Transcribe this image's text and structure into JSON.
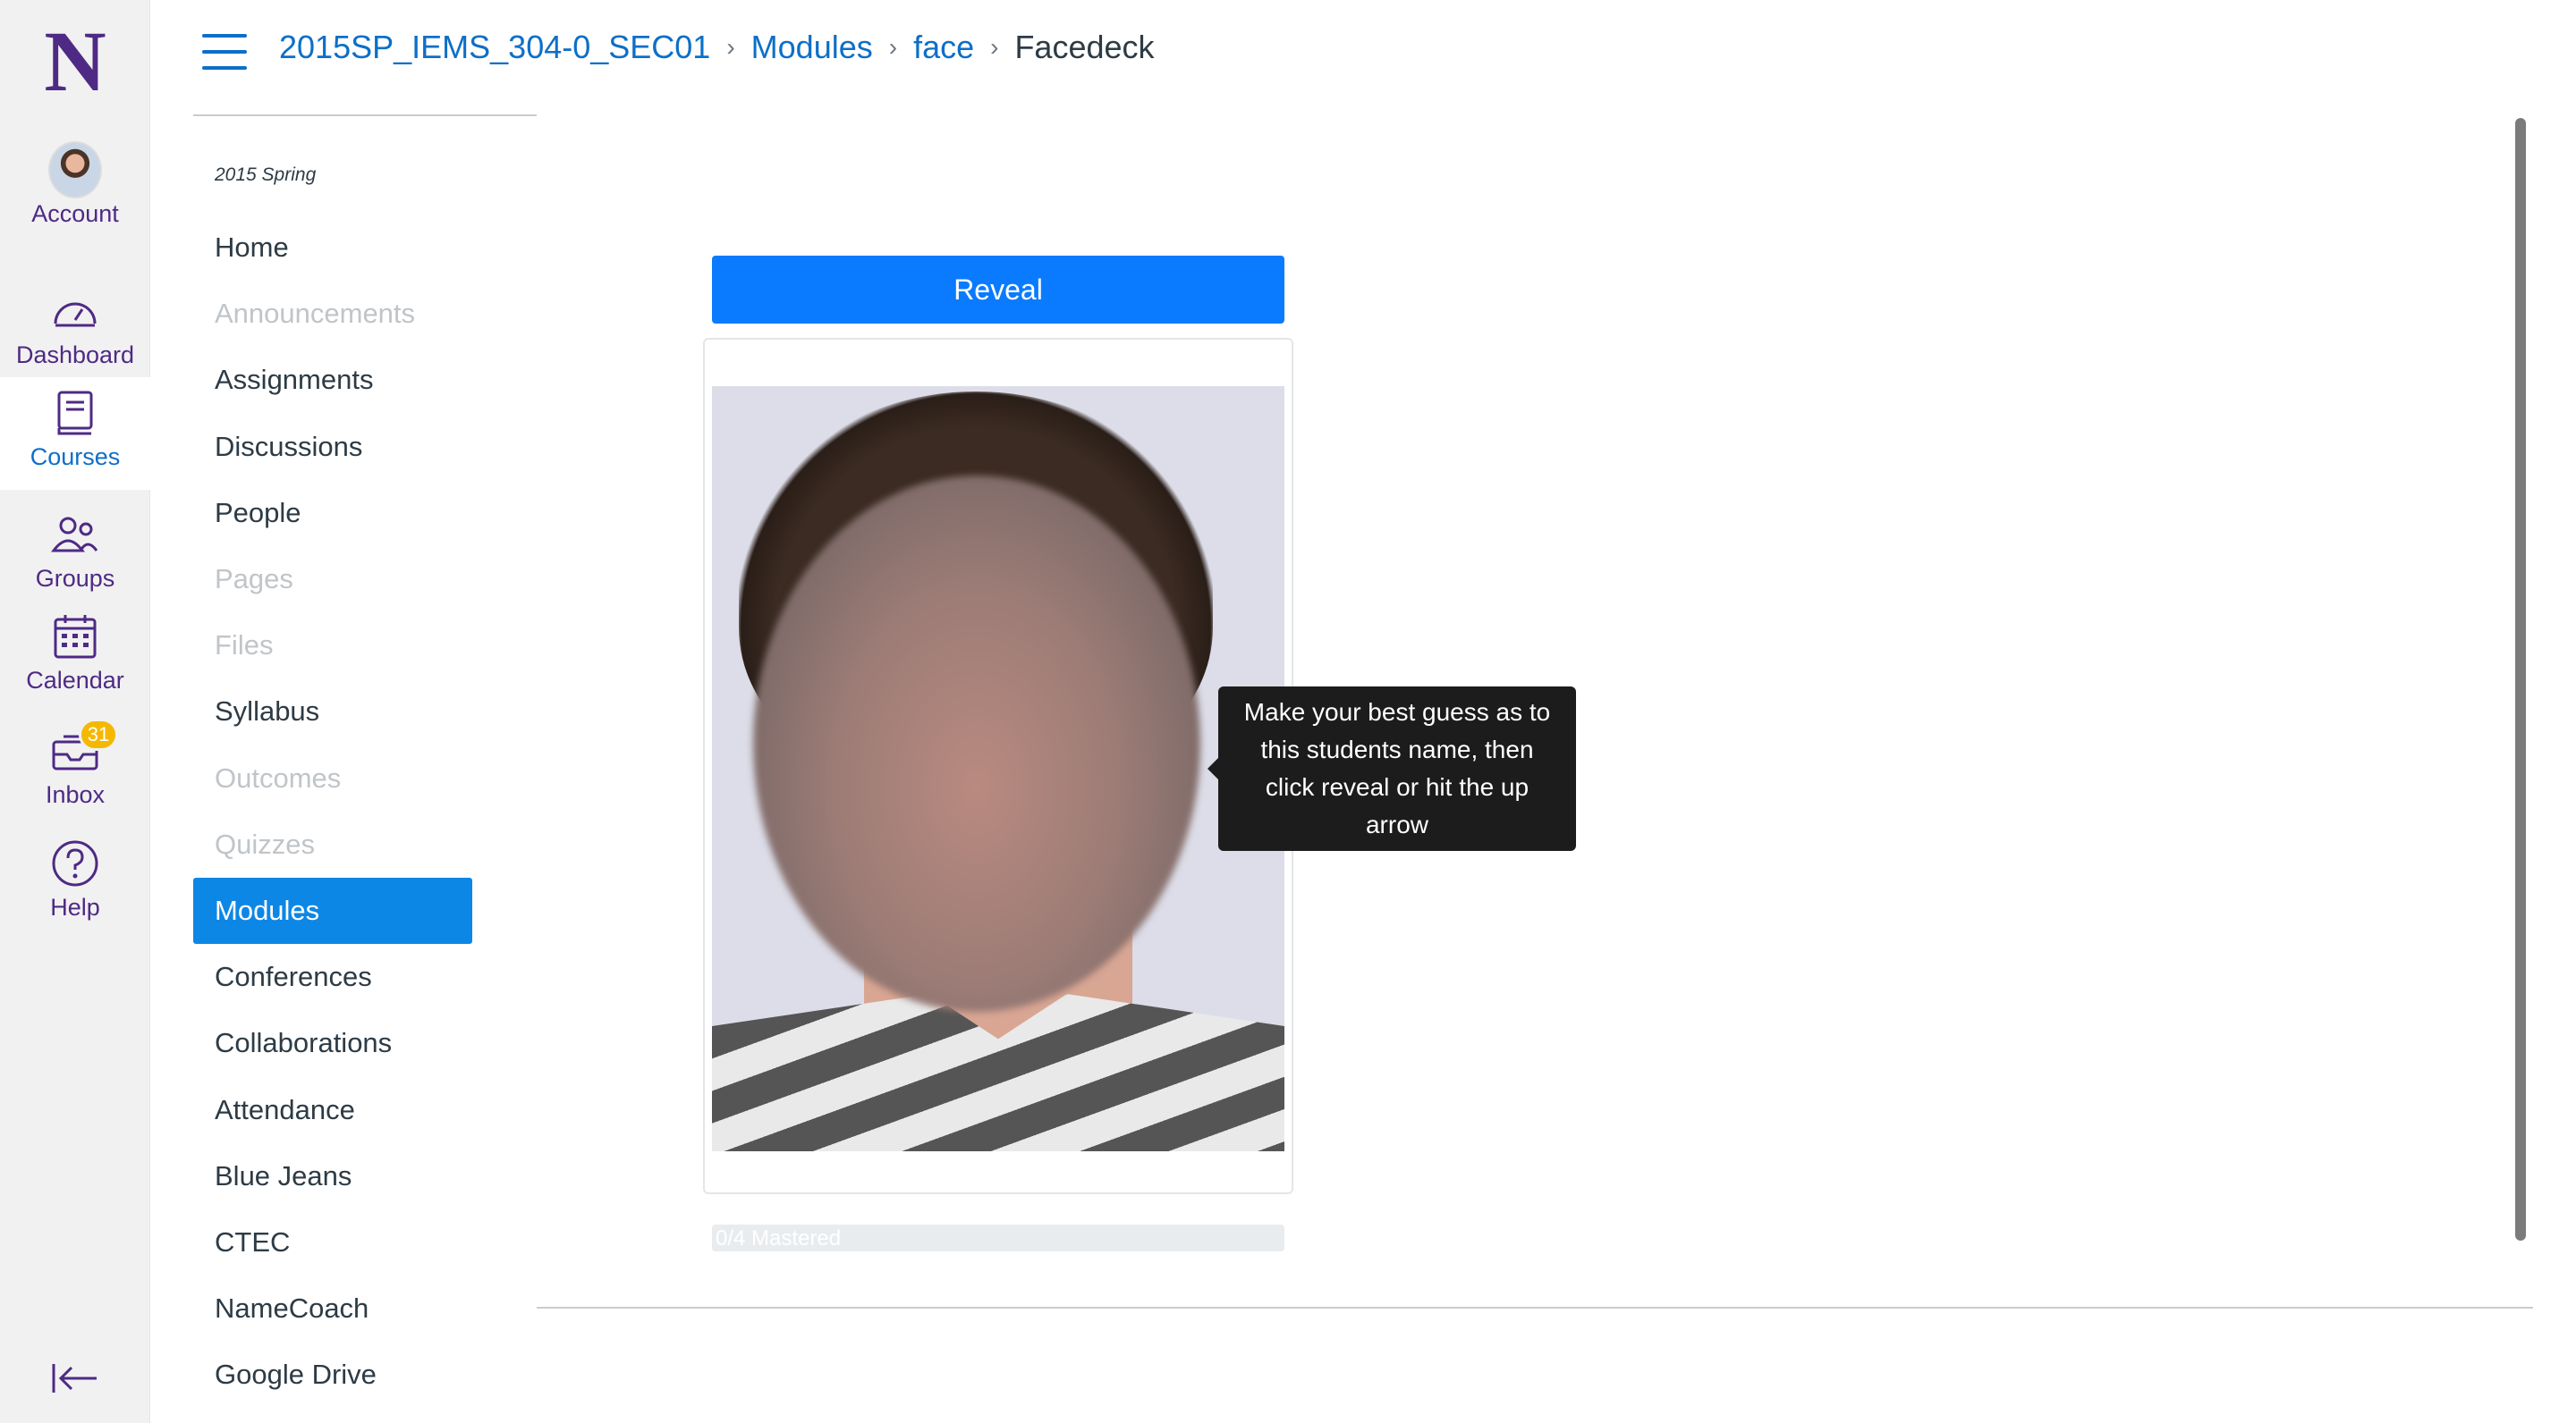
{
  "global_nav": {
    "logo": "N",
    "items": [
      {
        "label": "Account",
        "icon": "avatar"
      },
      {
        "label": "Dashboard",
        "icon": "dashboard-icon"
      },
      {
        "label": "Courses",
        "icon": "courses-icon",
        "active": true
      },
      {
        "label": "Groups",
        "icon": "groups-icon"
      },
      {
        "label": "Calendar",
        "icon": "calendar-icon"
      },
      {
        "label": "Inbox",
        "icon": "inbox-icon",
        "badge": "31"
      },
      {
        "label": "Help",
        "icon": "help-icon"
      }
    ],
    "collapse_icon": "collapse-arrow-icon"
  },
  "breadcrumb": {
    "course": "2015SP_IEMS_304-0_SEC01",
    "modules": "Modules",
    "face": "face",
    "current": "Facedeck"
  },
  "course_nav": {
    "term": "2015 Spring",
    "items": [
      {
        "label": "Home",
        "state": "normal"
      },
      {
        "label": "Announcements",
        "state": "disabled"
      },
      {
        "label": "Assignments",
        "state": "normal"
      },
      {
        "label": "Discussions",
        "state": "normal"
      },
      {
        "label": "People",
        "state": "normal"
      },
      {
        "label": "Pages",
        "state": "disabled"
      },
      {
        "label": "Files",
        "state": "disabled"
      },
      {
        "label": "Syllabus",
        "state": "normal"
      },
      {
        "label": "Outcomes",
        "state": "disabled"
      },
      {
        "label": "Quizzes",
        "state": "disabled"
      },
      {
        "label": "Modules",
        "state": "active"
      },
      {
        "label": "Conferences",
        "state": "normal"
      },
      {
        "label": "Collaborations",
        "state": "normal"
      },
      {
        "label": "Attendance",
        "state": "normal"
      },
      {
        "label": "Blue Jeans",
        "state": "normal"
      },
      {
        "label": "CTEC",
        "state": "normal"
      },
      {
        "label": "NameCoach",
        "state": "normal"
      },
      {
        "label": "Google Drive",
        "state": "normal"
      }
    ]
  },
  "facedeck": {
    "reveal_label": "Reveal",
    "tooltip": "Make your best guess as to this students name, then click reveal or hit the up arrow",
    "progress_label": "0/4 Mastered",
    "progress_fraction": 0.0
  },
  "colors": {
    "brand_purple": "#4e2a84",
    "link_blue": "#0d6fc8",
    "active_nav": "#0d87e6",
    "button_blue": "#0a7bff",
    "badge": "#f5b800"
  }
}
